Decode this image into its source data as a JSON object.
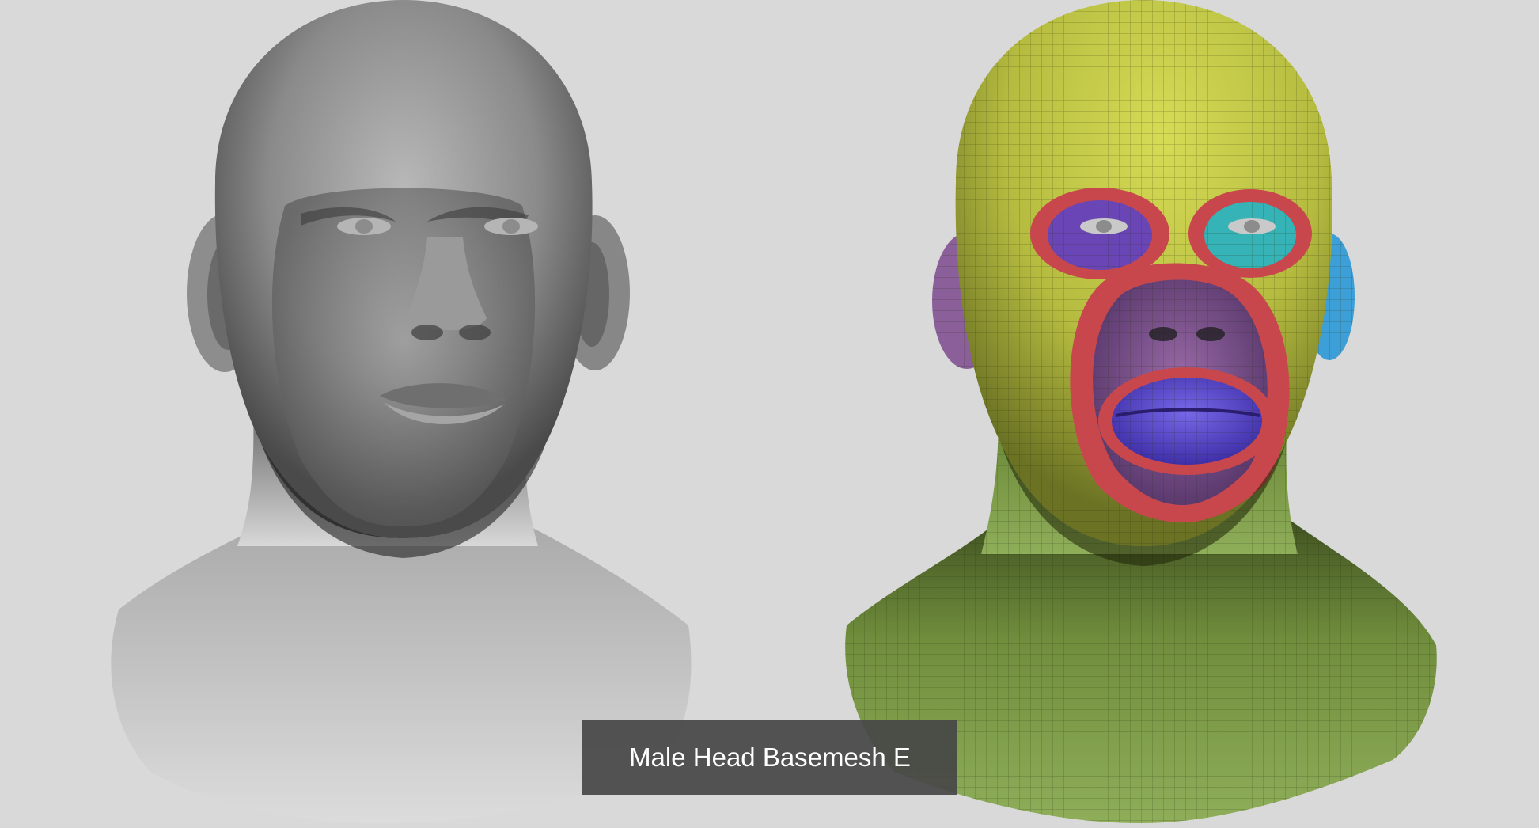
{
  "caption": {
    "title": "Male Head Basemesh E"
  },
  "colors": {
    "background": "#d9d9d9",
    "clay": "#8c8c8c",
    "polygroup_head": "#c3c94a",
    "polygroup_neck": "#85a34c",
    "polygroup_red": "#c7474d",
    "polygroup_purple": "#7a4c8f",
    "polygroup_blue": "#5b4bc8",
    "polygroup_cyan": "#35b3b6",
    "polygroup_ear_blue": "#3d9fd8"
  },
  "images": {
    "left": "clay-render-head-icon",
    "right": "polygroup-wireframe-head-icon"
  }
}
